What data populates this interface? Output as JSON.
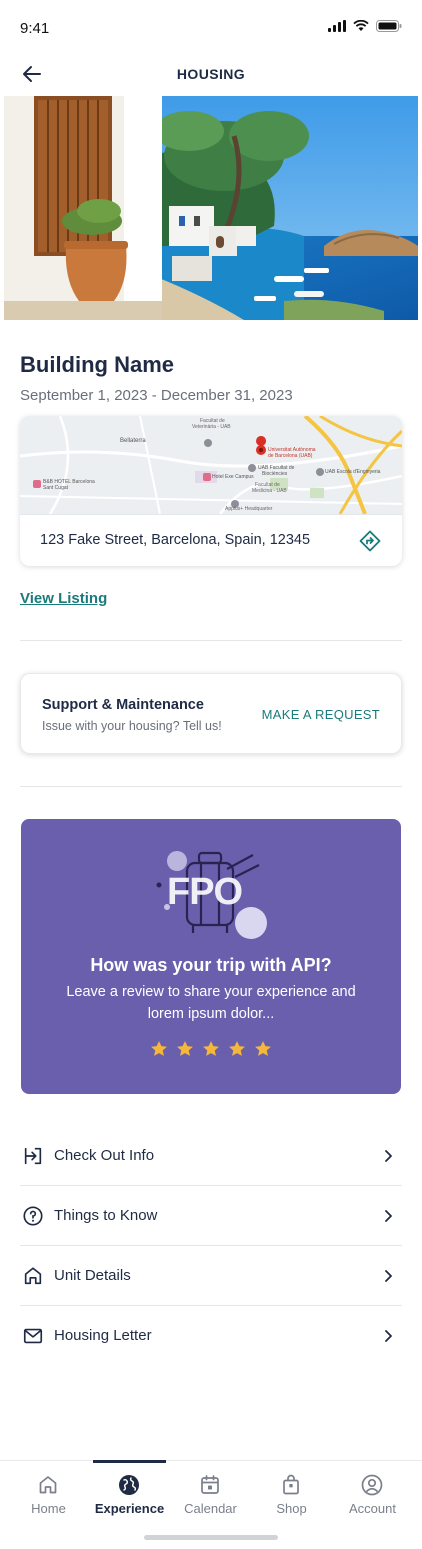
{
  "status_bar": {
    "time": "9:41"
  },
  "header": {
    "title": "HOUSING"
  },
  "building": {
    "name": "Building Name",
    "dates": "September 1, 2023 - December 31, 2023",
    "address": "123 Fake Street, Barcelona, Spain, 12345",
    "view_listing": "View Listing"
  },
  "map": {
    "labels": {
      "bellaterra": "Bellaterra",
      "facultat_veterinaria_1": "Facultat de",
      "facultat_veterinaria_2": "Veterinària - UAB",
      "universitat_1": "Universitat Autònoma",
      "universitat_2": "de Barcelona (UAB)",
      "uab_facultat_1": "UAB Facultat de",
      "uab_facultat_2": "Biociències",
      "hotel_1": "B&B HOTEL Barcelona",
      "hotel_2": "Sant Cugat",
      "hotel_exe": "Hotel Exe Campus",
      "medicina_1": "Facultat de",
      "medicina_2": "Medicina - UAB",
      "escola": "UAB Escola d'Enginyeria",
      "applus": "Applus+ Headquarter"
    }
  },
  "support": {
    "title": "Support & Maintenance",
    "subtitle": "Issue with your housing? Tell us!",
    "action": "MAKE A REQUEST"
  },
  "review": {
    "placeholder_text": "FPO",
    "title": "How was your trip with API?",
    "body": "Leave a review to share your experience and lorem ipsum dolor...",
    "rating_stars": 5,
    "star_color": "#f5b63a"
  },
  "menu": [
    {
      "label": "Check Out Info",
      "icon": "check-out-icon"
    },
    {
      "label": "Things to Know",
      "icon": "question-icon"
    },
    {
      "label": "Unit Details",
      "icon": "home-icon"
    },
    {
      "label": "Housing Letter",
      "icon": "mail-icon"
    }
  ],
  "tabs": [
    {
      "label": "Home",
      "icon": "home-icon",
      "active": false
    },
    {
      "label": "Experience",
      "icon": "globe-icon",
      "active": true
    },
    {
      "label": "Calendar",
      "icon": "calendar-icon",
      "active": false
    },
    {
      "label": "Shop",
      "icon": "bag-icon",
      "active": false
    },
    {
      "label": "Account",
      "icon": "account-icon",
      "active": false
    }
  ],
  "colors": {
    "primary_text": "#1f2a44",
    "accent_teal": "#1b7a7c",
    "review_bg": "#6a5fad"
  }
}
